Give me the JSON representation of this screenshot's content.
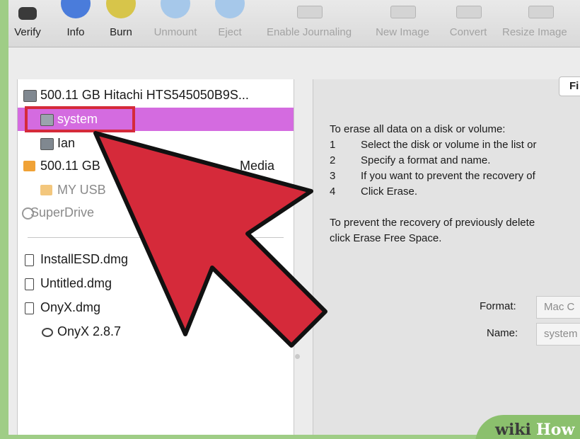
{
  "toolbar": {
    "verify": "Verify",
    "info": "Info",
    "burn": "Burn",
    "unmount": "Unmount",
    "eject": "Eject",
    "enable_journaling": "Enable Journaling",
    "new_image": "New Image",
    "convert": "Convert",
    "resize_image": "Resize Image"
  },
  "sidebar": {
    "items": [
      {
        "label": "500.11 GB Hitachi HTS545050B9S...",
        "icon": "hard-disk-icon"
      },
      {
        "label": "system",
        "icon": "volume-icon",
        "selected": true
      },
      {
        "label": "Ian",
        "icon": "volume-icon"
      },
      {
        "label": "500.11 GB",
        "label_tail": "Media",
        "icon": "usb-drive-icon"
      },
      {
        "label": "MY USB",
        "icon": "usb-drive-icon"
      },
      {
        "label": "SuperDrive",
        "icon": "optical-drive-icon"
      },
      {
        "label": "InstallESD.dmg",
        "icon": "dmg-file-icon"
      },
      {
        "label": "Untitled.dmg",
        "icon": "dmg-file-icon"
      },
      {
        "label": "OnyX.dmg",
        "icon": "dmg-file-icon"
      },
      {
        "label": "OnyX 2.8.7",
        "icon": "mounted-image-icon"
      }
    ]
  },
  "pane": {
    "tab_button": "Fi",
    "intro": "To erase all data on a disk or volume:",
    "steps": [
      {
        "n": "1",
        "text": "Select the disk or volume in the list or"
      },
      {
        "n": "2",
        "text": "Specify a format and name."
      },
      {
        "n": "3",
        "text": "If you want to prevent the recovery of"
      },
      {
        "n": "4",
        "text": "Click Erase."
      }
    ],
    "free_space_line1": "To prevent the recovery of previously delete",
    "free_space_line2": "click Erase Free Space.",
    "format_label": "Format:",
    "format_value": "Mac C",
    "name_label": "Name:",
    "name_value": "system"
  },
  "watermark": {
    "part1": "wiki",
    "part2": "How"
  },
  "colors": {
    "selection": "#d46be0",
    "arrow": "#d52a3a",
    "border": "#9fcd86"
  }
}
